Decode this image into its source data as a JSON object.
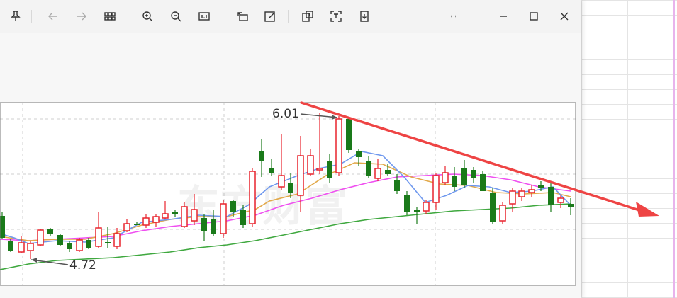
{
  "toolbar": {
    "items": [
      {
        "icon": "pin-icon",
        "name": "pin-button"
      },
      {
        "icon": "arrow-left-icon",
        "name": "back-button"
      },
      {
        "icon": "arrow-right-icon",
        "name": "forward-button"
      },
      {
        "icon": "grid-icon",
        "name": "thumbnails-button"
      },
      {
        "icon": "zoom-in-icon",
        "name": "zoom-in-button"
      },
      {
        "icon": "zoom-out-icon",
        "name": "zoom-out-button"
      },
      {
        "icon": "actual-size-icon",
        "name": "actual-size-button"
      },
      {
        "icon": "rotate-icon",
        "name": "rotate-button"
      },
      {
        "icon": "edit-icon",
        "name": "edit-button"
      },
      {
        "icon": "translate-icon",
        "name": "translate-button"
      },
      {
        "icon": "extract-text-icon",
        "name": "extract-text-button"
      },
      {
        "icon": "save-icon",
        "name": "save-button"
      },
      {
        "icon": "more-icon",
        "name": "more-button"
      },
      {
        "icon": "minimize-icon",
        "name": "minimize-button"
      },
      {
        "icon": "maximize-icon",
        "name": "maximize-button"
      },
      {
        "icon": "close-icon",
        "name": "close-button"
      }
    ]
  },
  "chart": {
    "high_label": "6.01",
    "low_label": "4.72",
    "watermark": "东方财富",
    "colors": {
      "up": "#e8232d",
      "down": "#1a7a1a",
      "ma5": "#6f98ee",
      "ma10": "#e2a94a",
      "ma20": "#ef4ff0",
      "ma60": "#3fa83f",
      "trend_arrow": "#ee4444"
    }
  }
}
